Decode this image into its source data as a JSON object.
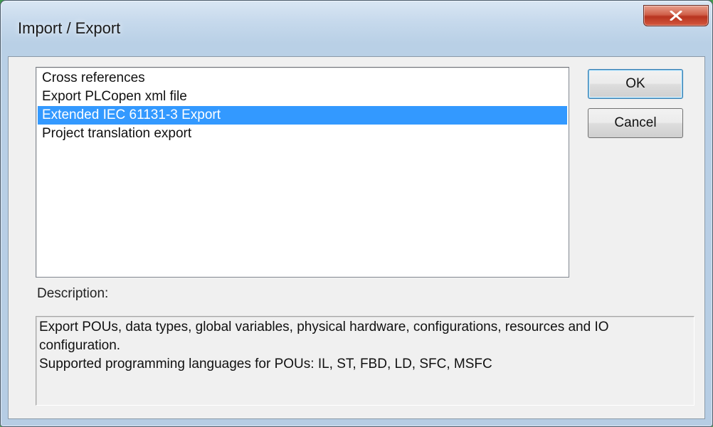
{
  "window": {
    "title": "Import / Export",
    "close_icon": "close-x-icon"
  },
  "list": {
    "items": [
      "Cross references",
      "Export PLCopen xml file",
      "Extended IEC 61131-3 Export",
      "Project translation export"
    ],
    "selected_index": 2
  },
  "buttons": {
    "ok": "OK",
    "cancel": "Cancel"
  },
  "description": {
    "label": "Description:",
    "lines": [
      "Export POUs, data types, global variables, physical hardware, configurations, resources and IO",
      "configuration.",
      "Supported programming languages for POUs: IL, ST, FBD, LD, SFC, MSFC"
    ]
  },
  "colors": {
    "selection": "#3399ff",
    "close_button": "#c9452e",
    "title_bar": "#c6d9ec"
  }
}
